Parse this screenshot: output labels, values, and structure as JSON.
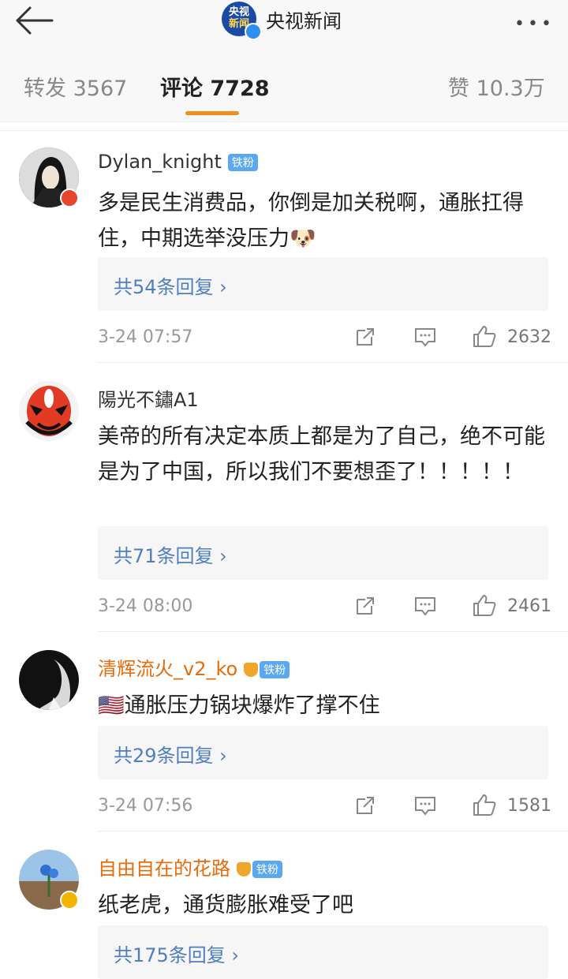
{
  "header": {
    "account_name": "央视新闻",
    "logo_line1": "央视",
    "logo_line2": "新闻",
    "more_label": "•••"
  },
  "tabs": [
    {
      "label": "转发 3567"
    },
    {
      "label": "评论 7728",
      "active": true
    },
    {
      "label": "赞 10.3万"
    }
  ],
  "comments": [
    {
      "username": "Dylan_knight",
      "fan_badge": "铁粉",
      "text": "多是民生消费品，你倒是加关税啊，通胀扛得住，中期选举没压力",
      "emoji": "🐶",
      "replies": "共54条回复 ›",
      "time": "3-24 07:57",
      "likes": "2632"
    },
    {
      "username": "陽光不鏽A1",
      "text": "美帝的所有决定本质上都是为了自己，绝不可能是为了中国，所以我们不要想歪了！！！！！",
      "replies": "共71条回复 ›",
      "time": "3-24 08:00",
      "likes": "2461"
    },
    {
      "username": "清辉流火_v2_ko",
      "fan_badge": "铁粉",
      "flag": "🇺🇸",
      "text": "通胀压力锅块爆炸了撑不住",
      "replies": "共29条回复 ›",
      "time": "3-24 07:56",
      "likes": "1581"
    },
    {
      "username": "自由自在的花路",
      "fan_badge": "铁粉",
      "text": "纸老虎，通货膨胀难受了吧",
      "replies": "共175条回复 ›"
    }
  ],
  "colors": {
    "accent": "#f28c1a",
    "link": "#4f7fbe",
    "vip_name": "#e86b0c"
  }
}
